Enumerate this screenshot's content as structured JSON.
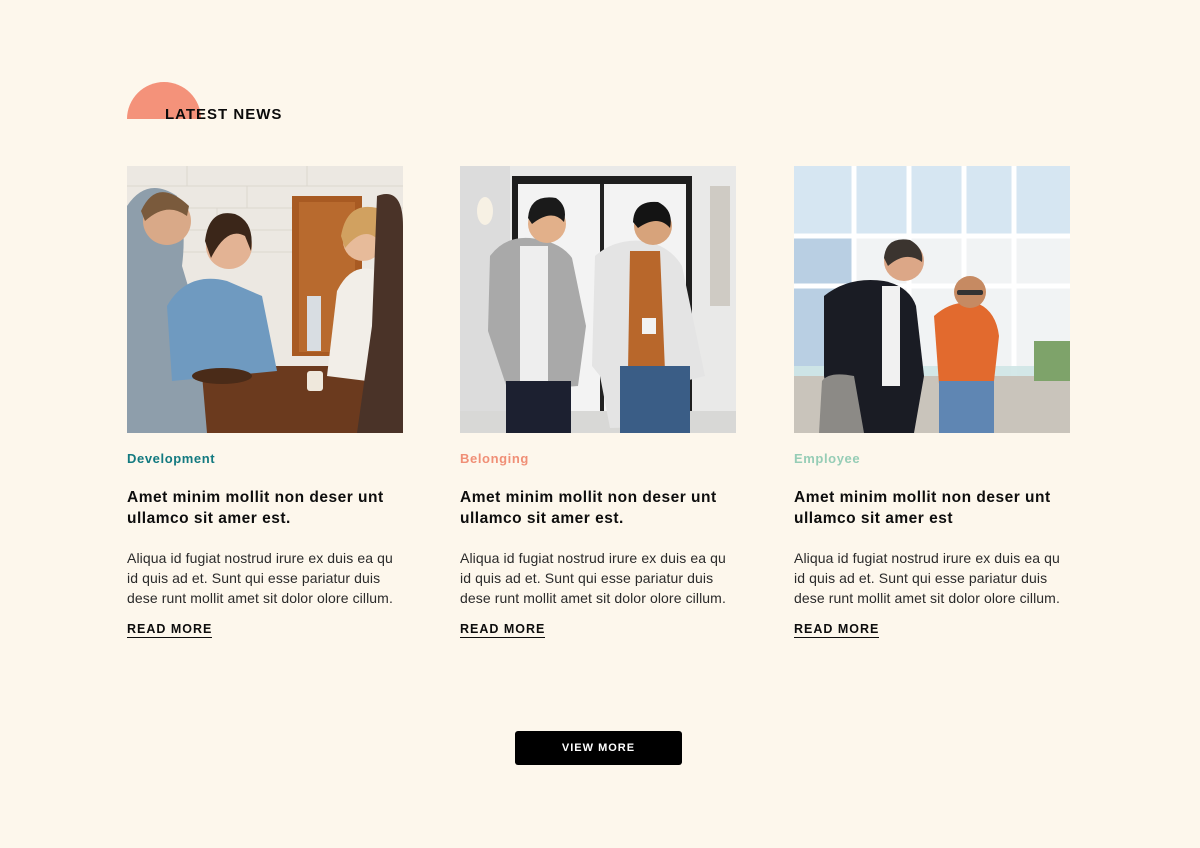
{
  "section": {
    "title": "LATEST NEWS"
  },
  "colors": {
    "background": "#fdf7ec",
    "accent_sun": "#f4927a",
    "development": "#137a80",
    "belonging": "#f08f76",
    "employee": "#96cdb6",
    "button_bg": "#000000",
    "button_text": "#ffffff"
  },
  "cards": [
    {
      "category": "Development",
      "category_color": "#137a80",
      "title": "Amet minim mollit non deser unt ullamco sit amer est.",
      "body": "Aliqua id fugiat nostrud irure ex duis ea qu id quis ad et. Sunt qui esse pariatur duis dese runt mollit amet sit dolor olore cillum.",
      "link": "READ MORE",
      "image": "photo-group-of-colleagues-at-table"
    },
    {
      "category": "Belonging",
      "category_color": "#f08f76",
      "title": "Amet minim mollit non deser unt ullamco sit amer est.",
      "body": "Aliqua id fugiat nostrud irure ex duis ea qu id quis ad et. Sunt qui esse pariatur duis dese runt mollit amet sit dolor olore cillum.",
      "link": "READ MORE",
      "image": "photo-two-men-walking-in-hallway"
    },
    {
      "category": "Employee",
      "category_color": "#96cdb6",
      "title": "Amet minim mollit non deser unt ullamco sit amer est",
      "body": "Aliqua id fugiat nostrud irure ex duis ea qu id quis ad et. Sunt qui esse pariatur duis dese runt mollit amet sit dolor olore cillum.",
      "link": "READ MORE",
      "image": "photo-two-men-in-bright-office"
    }
  ],
  "view_more": {
    "label": "VIEW MORE"
  }
}
